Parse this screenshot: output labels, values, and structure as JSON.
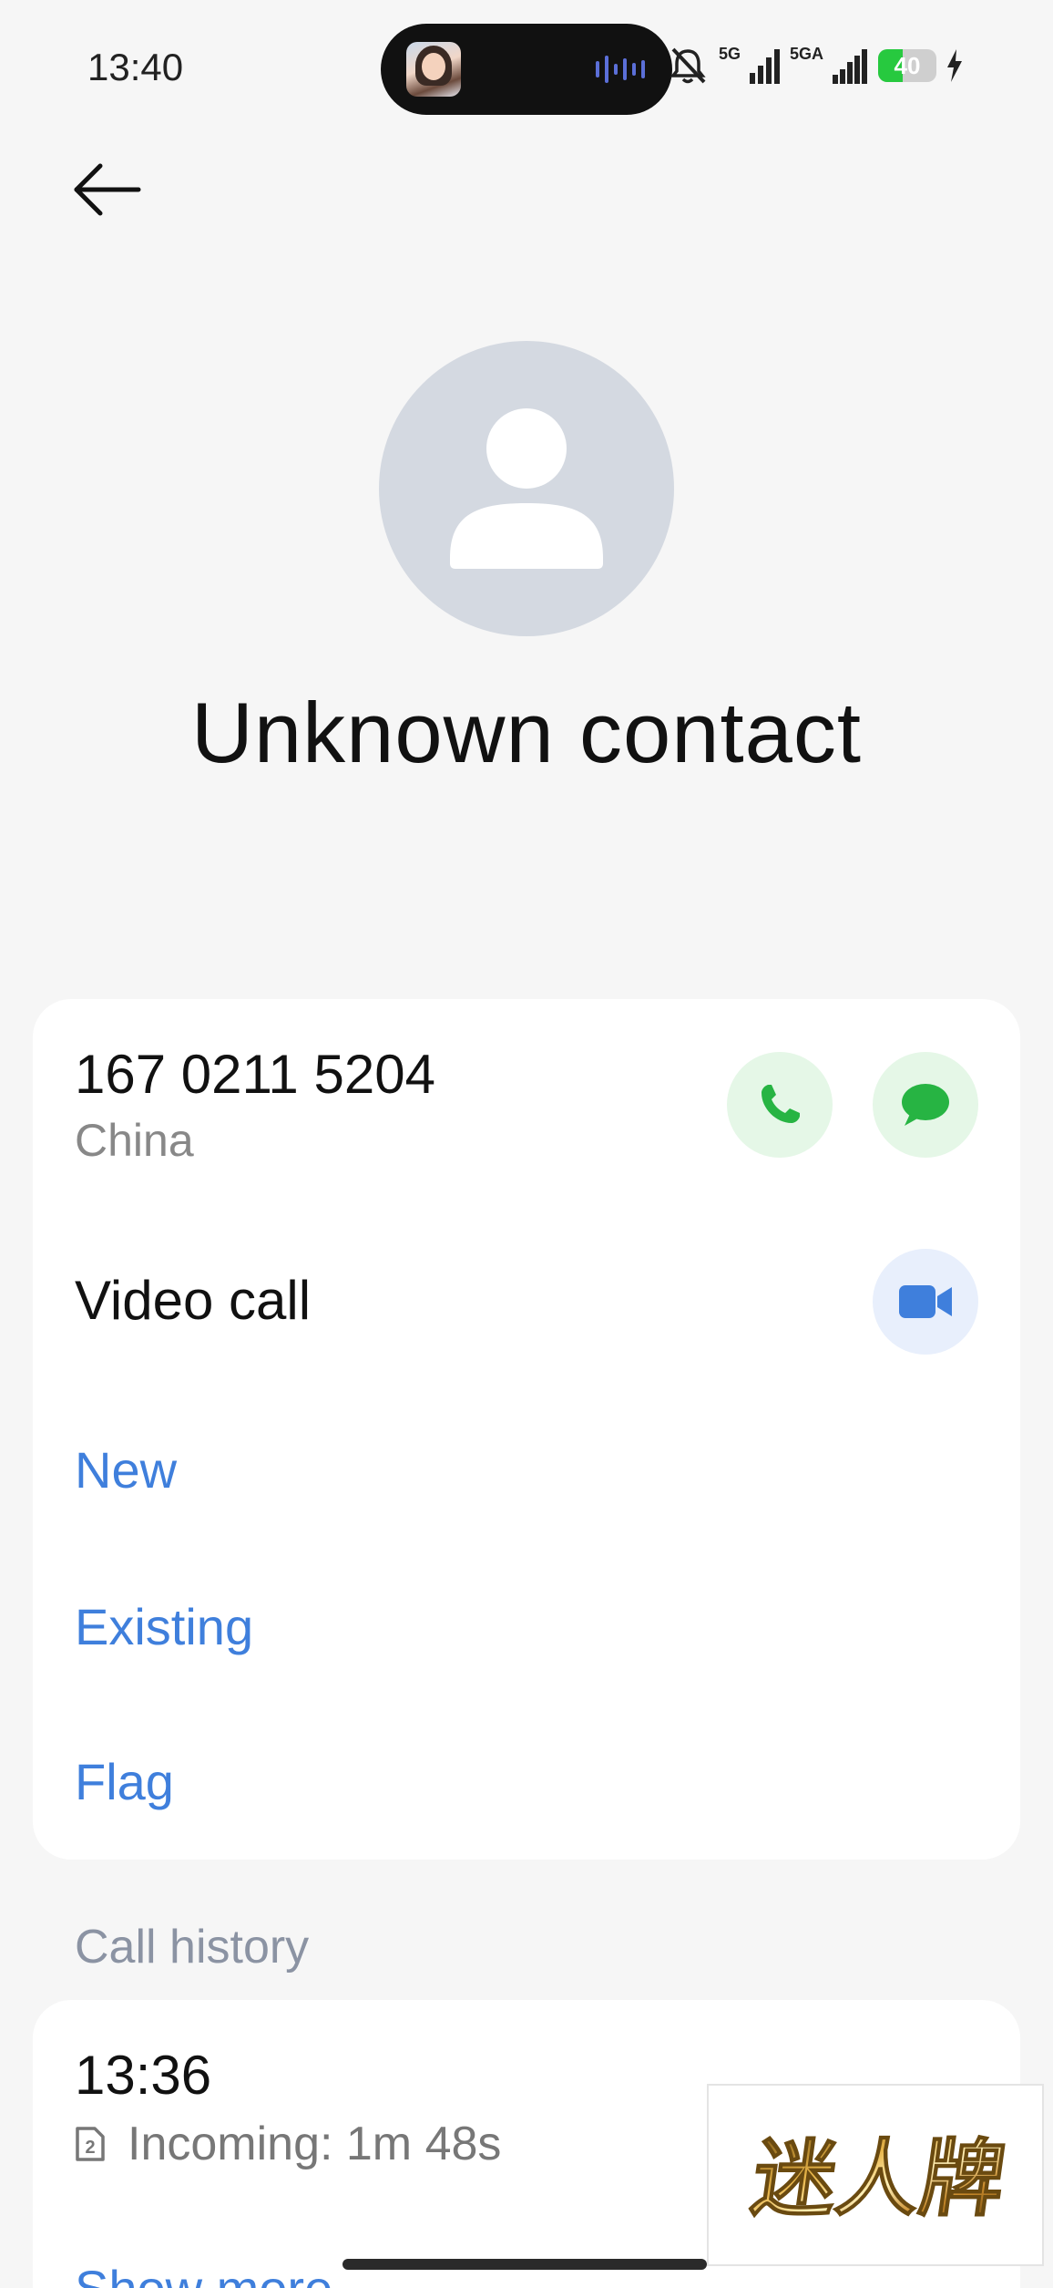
{
  "status_bar": {
    "time": "13:40",
    "network_1": "5G",
    "network_2": "5GA",
    "battery_level": "40",
    "icons": [
      "mute-bell-icon",
      "signal-icon",
      "signal-icon",
      "battery-icon",
      "charging-bolt-icon"
    ]
  },
  "contact": {
    "name": "Unknown contact",
    "phone_number": "167 0211 5204",
    "region": "China"
  },
  "actions": {
    "video_call_label": "Video call",
    "new_label": "New",
    "existing_label": "Existing",
    "flag_label": "Flag"
  },
  "call_history": {
    "title": "Call history",
    "entries": [
      {
        "time": "13:36",
        "sim": "2",
        "detail": "Incoming: 1m 48s"
      }
    ],
    "show_more_label": "Show more"
  },
  "watermark": {
    "text": "迷人牌"
  },
  "colors": {
    "accent_blue": "#3f7fdc",
    "call_green": "#27b443",
    "background": "#f6f6f6",
    "card": "#ffffff",
    "avatar_gray": "#d4d9e1"
  }
}
